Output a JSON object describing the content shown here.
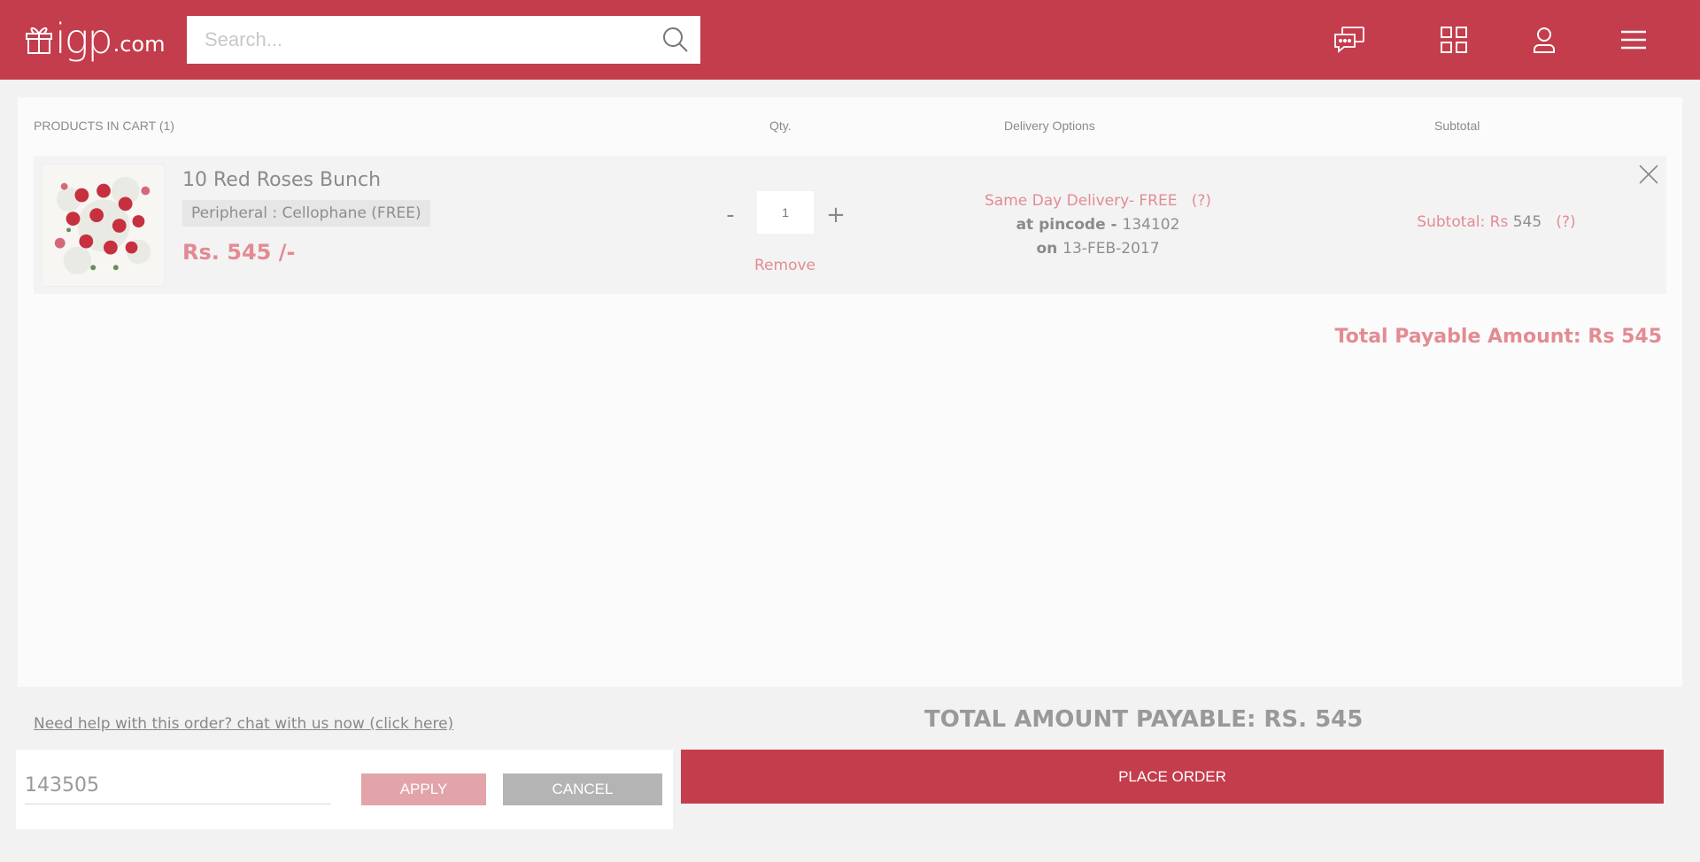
{
  "header": {
    "logo_main": "igp",
    "logo_suffix": ".com",
    "search_placeholder": "Search..."
  },
  "cart": {
    "columns": {
      "products": "PRODUCTS IN CART (1)",
      "qty": "Qty.",
      "delivery": "Delivery Options",
      "subtotal": "Subtotal"
    },
    "item": {
      "name": "10 Red Roses Bunch",
      "addon": "Peripheral : Cellophane (FREE)",
      "price": "Rs. 545 /-",
      "qty_minus": "-",
      "qty_value": "1",
      "qty_plus": "+",
      "remove_label": "Remove",
      "delivery_type": "Same Day Delivery- FREE",
      "delivery_help": "(?)",
      "pincode_prefix": "at pincode - ",
      "pincode": "134102",
      "date_prefix": "on ",
      "date": "13-FEB-2017",
      "subtotal_label": "Subtotal: Rs ",
      "subtotal_value": "545",
      "subtotal_help": "(?)"
    },
    "total_payable": "Total Payable Amount: Rs 545"
  },
  "footer": {
    "help_link": "Need help with this order? chat with us now (click here)",
    "grand_total": "TOTAL AMOUNT PAYABLE: RS. 545",
    "coupon_value": "143505",
    "apply_label": "APPLY",
    "cancel_label": "CANCEL",
    "place_order_label": "PLACE ORDER"
  },
  "colors": {
    "brand": "#c43d4c",
    "accent_light": "#e38b93"
  }
}
